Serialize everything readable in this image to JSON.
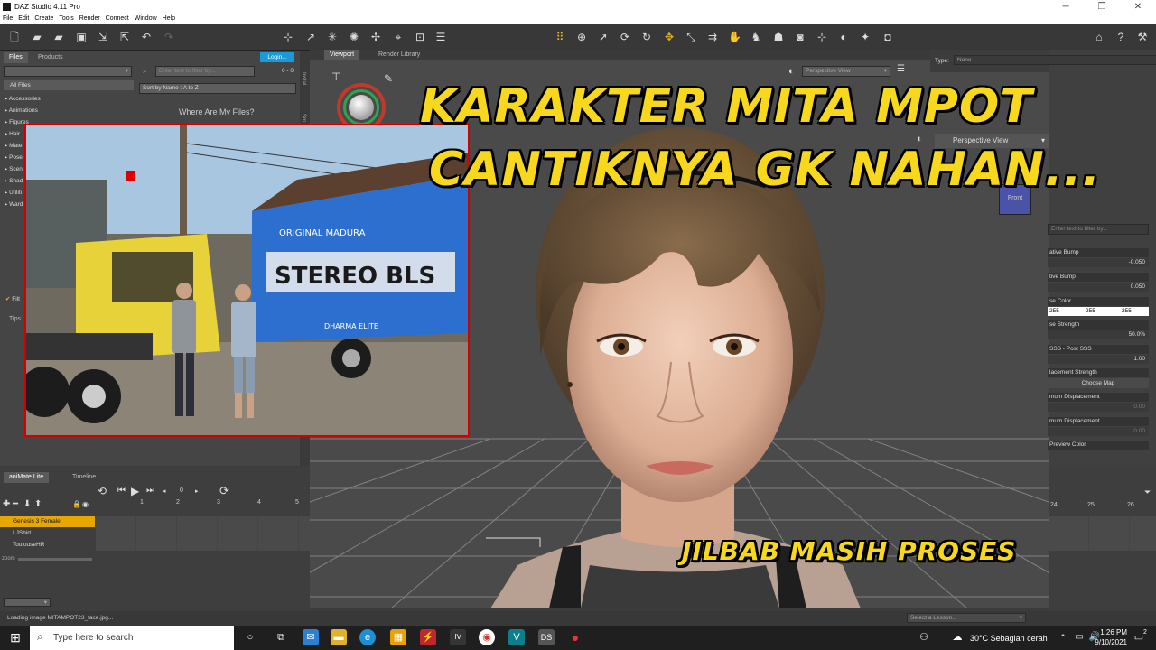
{
  "window": {
    "title": "DAZ Studio 4.11 Pro",
    "minimize": "─",
    "maximize": "❐",
    "close": "✕"
  },
  "menu": [
    "File",
    "Edit",
    "Create",
    "Tools",
    "Render",
    "Connect",
    "Window",
    "Help"
  ],
  "content_library": {
    "tabs": [
      "Files",
      "Products"
    ],
    "login_label": "Login...",
    "filter_placeholder": "Enter text to filter by...",
    "result_count": "0 - 0",
    "sort_label": "Sort by Name : A to Z",
    "where_label": "Where Are My Files?",
    "all_files": "All Files",
    "tree": [
      "Accessories",
      "Animations",
      "Figures",
      "Hair",
      "Mate",
      "Pose",
      "Scen",
      "Shad",
      "Utiliti",
      "Ward"
    ],
    "filter_check": "Filt",
    "tips_tab": "Tips",
    "side_tabs": [
      "Instal",
      "Sm"
    ]
  },
  "viewport": {
    "tabs": [
      "Viewport",
      "Render Library"
    ],
    "view_label": "Perspective View",
    "aux_view_label": "Perspective View",
    "front_label": "Front"
  },
  "parameters": {
    "type_label": "Type:",
    "type_value": "None",
    "filter_placeholder": "Enter text to filter by...",
    "rows": [
      {
        "label": "Negative Bump",
        "value": "-0.050"
      },
      {
        "label": "Positive Bump",
        "value": "0.050"
      },
      {
        "label": "Base Color",
        "value": ""
      },
      {
        "label": "Base Strength",
        "value": "50.0%"
      },
      {
        "label": "SSS - Post SSS",
        "value": "1.00"
      },
      {
        "label": "Displacement Strength",
        "value": ""
      },
      {
        "label": "Minimum Displacement",
        "value": "0.00"
      },
      {
        "label": "Maximum Displacement",
        "value": "0.00"
      },
      {
        "label": "Preview Color",
        "value": ""
      }
    ],
    "color_values": [
      "255",
      "255",
      "255"
    ],
    "choose_map": "Choose Map",
    "label_prefixes": [
      "ative Bump",
      "tive Bump",
      "se Color",
      "se Strength",
      "SSS - Post SSS",
      "lacement Strength",
      "mum Displacement",
      "mum Displacement",
      "Preview Color"
    ]
  },
  "timeline": {
    "tabs": [
      "aniMate Lite",
      "Timeline"
    ],
    "frame_value": "0",
    "ruler_left": [
      "1",
      "2",
      "3",
      "4",
      "5"
    ],
    "ruler_right": [
      "24",
      "25",
      "26"
    ],
    "tracks": [
      "Genesis 3 Female",
      "LJShirt",
      "ToulouseHR"
    ],
    "zoom_label": "zoom"
  },
  "status": {
    "loading": "Loading image MITAMPOT23_face.jpg...",
    "lesson_placeholder": "Select a Lesson..."
  },
  "captions": {
    "line1": "KARAKTER MITA MPOT",
    "line2": "CANTIKNYA GK NAHAN...",
    "line3": "JILBAB MASIH PROSES"
  },
  "inset": {
    "truck_text": "ORIGINAL MADURA",
    "truck_text2": "DHARMA ELITE"
  },
  "taskbar": {
    "search_placeholder": "Type here to search",
    "weather": "30°C  Sebagian cerah",
    "time": "1:26 PM",
    "date": "9/10/2021",
    "notif_count": "2"
  },
  "colors": {
    "accent_yellow": "#f7d81c",
    "track_highlight": "#e6a800",
    "login_button": "#1a9ad6"
  }
}
